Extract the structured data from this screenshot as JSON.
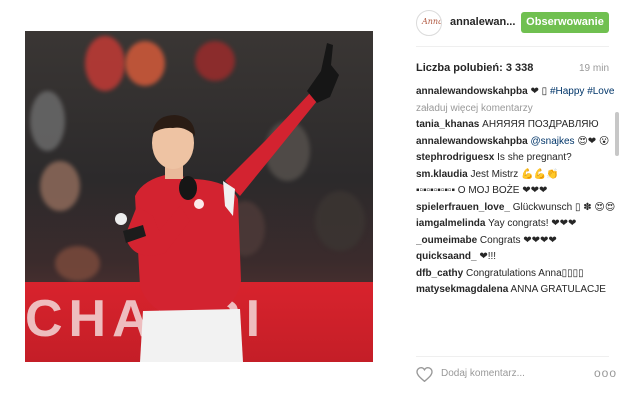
{
  "post": {
    "username": "annalewan...",
    "follow_label": "Obserwowanie",
    "likes": "Liczba polubień: 3 338",
    "time": "19 min",
    "banner_text": "CHAMPI",
    "avatar_text": "Anna"
  },
  "caption": {
    "user": "annalewandowskahpba",
    "text": "❤ ▯ ",
    "tag1": "#Happy",
    "tag2": "#Love"
  },
  "load_more": "załaduj więcej komentarzy",
  "comments": [
    {
      "user": "tania_khanas",
      "text": "АНЯЯЯЯ ПОЗДРАВЛЯЮ"
    },
    {
      "user": "annalewandowskahpba",
      "text": "😍❤ 😮",
      "mention": "@snajkes"
    },
    {
      "user": "stephrodriguesx",
      "text": "Is she pregnant?"
    },
    {
      "user": "sm.klaudia",
      "text": "Jest Mistrz 💪💪👏"
    },
    {
      "user": "▪▫▪▫▪▫▪▫▪▫▪",
      "text": "O MOJ BOŻE ❤❤❤"
    },
    {
      "user": "spielerfrauen_love_",
      "text": "Glückwunsch ▯ ✽ 😍😍"
    },
    {
      "user": "iamgalmelinda",
      "text": "Yay congrats! ❤❤❤"
    },
    {
      "user": "_oumeimabe",
      "text": "Congrats ❤❤❤❤"
    },
    {
      "user": "quicksaand_",
      "text": "❤!!!"
    },
    {
      "user": "dfb_cathy",
      "text": "Congratulations Anna▯▯▯▯"
    },
    {
      "user": "matysekmagdalena",
      "text": "ANNA GRATULACJE"
    }
  ],
  "footer": {
    "add_comment_placeholder": "Dodaj komentarz...",
    "more_label": "ooo"
  },
  "colors": {
    "follow_button": "#70c050",
    "hashtag": "#003569",
    "jersey_red": "#d32330"
  },
  "icons": {
    "like": "heart-outline-icon",
    "more": "more-options-icon"
  }
}
